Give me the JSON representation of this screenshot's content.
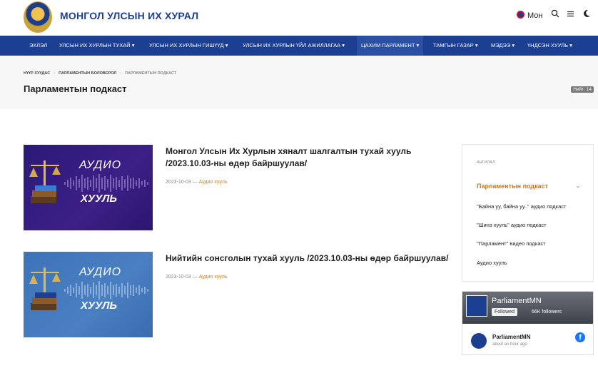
{
  "header": {
    "site_title": "МОНГОЛ УЛСЫН ИХ ХУРАЛ",
    "language": "Мон",
    "icons": [
      "search-icon",
      "menu-icon",
      "moon-icon"
    ]
  },
  "nav": {
    "items": [
      {
        "label": "ЭХЛЭЛ"
      },
      {
        "label": "УЛСЫН ИХ ХУРЛЫН ТУХАЙ ▾"
      },
      {
        "label": "УЛСЫН ИХ ХУРЛЫН ГИШҮҮД ▾"
      },
      {
        "label": "УЛСЫН ИХ ХУРЛЫН ҮЙЛ АЖИЛЛАГАА ▾"
      },
      {
        "label": "ЦАХИМ ПАРЛАМЕНТ ▾"
      },
      {
        "label": "ТАМГЫН ГАЗАР ▾"
      },
      {
        "label": "МЭДЭЭ ▾"
      },
      {
        "label": "ҮНДСЭН ХУУЛЬ ▾"
      }
    ]
  },
  "breadcrumb": {
    "home": "НҮҮР ХУУДАС",
    "section": "ПАРЛАМЕНТЫН БОЛОВСРОЛ",
    "current": "ПАРЛАМЕНТЫН ПОДКАСТ"
  },
  "page": {
    "title": "Парламентын подкаст",
    "total": "Нийт: 14"
  },
  "posts": [
    {
      "thumb_audio": "АУДИО",
      "thumb_law": "ХУУЛЬ",
      "title_line1": "Монгол Улсын Их Хурлын хяналт шалгалтын тухай хууль",
      "title_line2": "/2023.10.03-ны өдөр байршуулав/",
      "date": "2023-10-03 — ",
      "category": "Аудио хууль"
    },
    {
      "thumb_audio": "АУДИО",
      "thumb_law": "ХУУЛЬ",
      "title_line1": "Нийтийн сонсголын тухай хууль /2023.10.03-ны өдөр байршуулав/",
      "date": "2023-10-03 — ",
      "category": "Аудио хууль"
    }
  ],
  "sidebar": {
    "label": "АНГИЛАЛ",
    "active": "Парламентын подкаст",
    "items": [
      {
        "label": "\"Байна уу, байна уу..\" аудио подкаст"
      },
      {
        "label": "\"Шинэ хууль\" аудио подкаст"
      },
      {
        "label": "\"Парламент\" видео подкаст"
      },
      {
        "label": "Аудио хууль"
      }
    ]
  },
  "facebook": {
    "page_name": "ParliamentMN",
    "followed": "Followed",
    "followers": "66K followers",
    "post_name": "ParliamentMN",
    "post_time": "about an hour ago"
  },
  "colors": {
    "brand": "#1d3f91",
    "accent": "#d97706",
    "thumb1": "#2a1a78",
    "thumb2": "#3d73b8"
  }
}
